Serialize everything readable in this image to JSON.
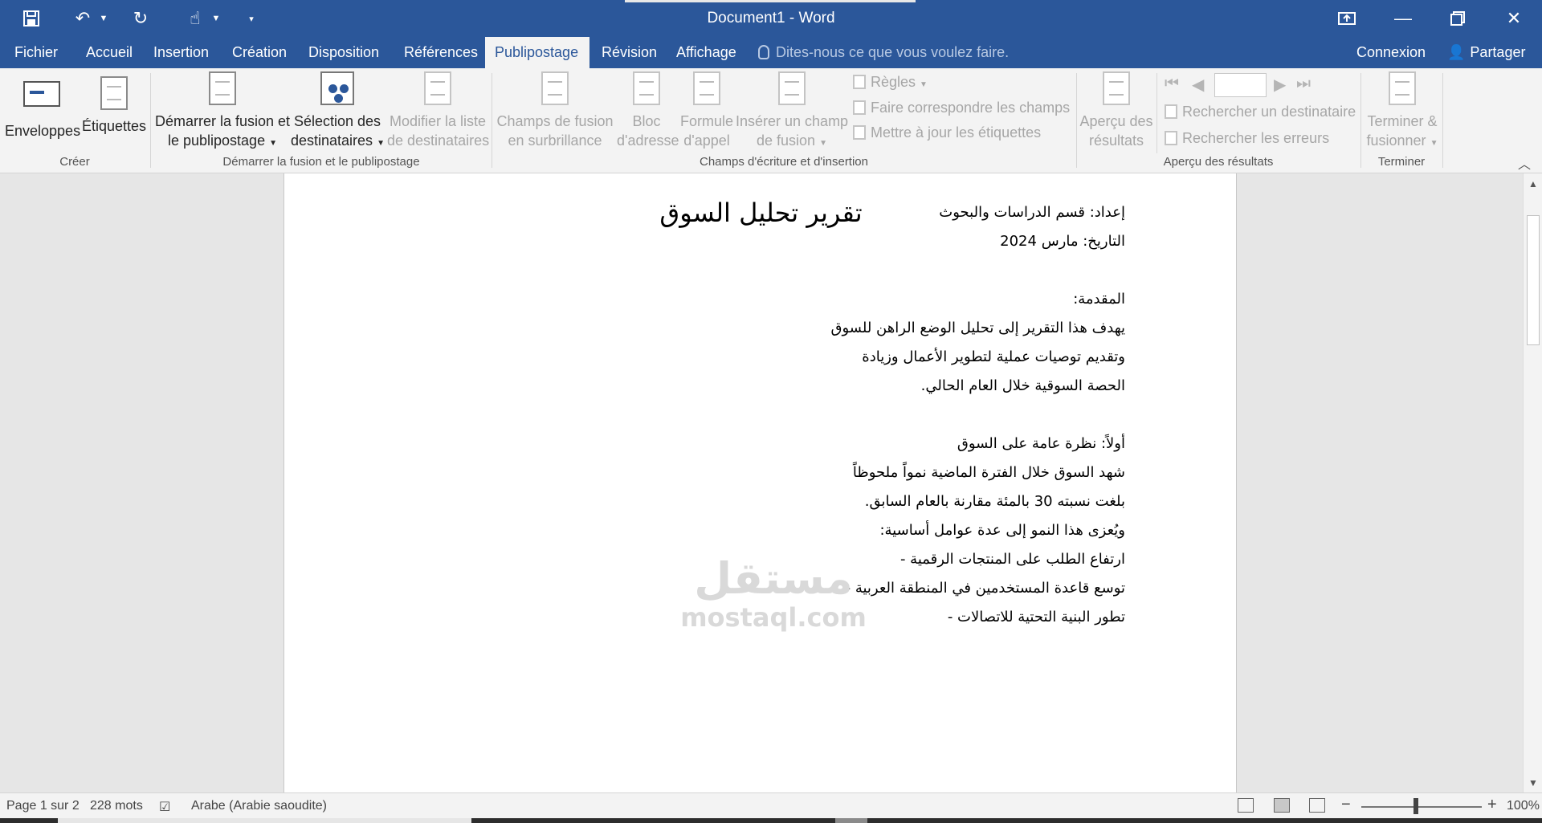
{
  "window": {
    "title": "Document1 - Word",
    "controls": [
      "restore-ribbon",
      "minimize",
      "maximize",
      "close"
    ]
  },
  "quick_access": [
    "save-icon",
    "undo-icon",
    "redo-icon",
    "touch-mode-icon",
    "customize-icon"
  ],
  "tabs": [
    {
      "label": "Fichier"
    },
    {
      "label": "Accueil"
    },
    {
      "label": "Insertion"
    },
    {
      "label": "Création"
    },
    {
      "label": "Disposition"
    },
    {
      "label": "Références"
    },
    {
      "label": "Publipostage",
      "active": true
    },
    {
      "label": "Révision"
    },
    {
      "label": "Affichage"
    }
  ],
  "tell_me": "Dites-nous ce que vous voulez faire.",
  "account": {
    "signin": "Connexion",
    "share": "Partager"
  },
  "ribbon": {
    "create": {
      "label": "Créer",
      "envelopes": "Enveloppes",
      "labels": "Étiquettes"
    },
    "start": {
      "label": "Démarrer la fusion et le publipostage",
      "start_merge_1": "Démarrer la fusion et",
      "start_merge_2": "le publipostage",
      "select_1": "Sélection des",
      "select_2": "destinataires",
      "edit_1": "Modifier la liste",
      "edit_2": "de destinataires"
    },
    "write": {
      "label": "Champs d'écriture et d'insertion",
      "highlight_1": "Champs de fusion",
      "highlight_2": "en surbrillance",
      "address_1": "Bloc",
      "address_2": "d'adresse",
      "greeting_1": "Formule",
      "greeting_2": "d'appel",
      "insert_1": "Insérer un champ",
      "insert_2": "de fusion",
      "rules": "Règles",
      "match": "Faire correspondre les champs",
      "update": "Mettre à jour les étiquettes"
    },
    "preview": {
      "label": "Aperçu des résultats",
      "preview_1": "Aperçu des",
      "preview_2": "résultats",
      "find": "Rechercher un destinataire",
      "check": "Rechercher les erreurs"
    },
    "finish": {
      "label": "Terminer",
      "finish_1": "Terminer &",
      "finish_2": "fusionner"
    }
  },
  "document": {
    "title": "تقرير تحليل السوق",
    "lines": [
      "إعداد: قسم الدراسات والبحوث",
      "التاريخ: مارس 2024",
      "",
      "المقدمة:",
      "يهدف هذا التقرير إلى تحليل الوضع الراهن للسوق",
      "وتقديم توصيات عملية لتطوير الأعمال وزيادة",
      "الحصة السوقية خلال العام الحالي.",
      "",
      "أولاً: نظرة عامة على السوق",
      "شهد السوق خلال الفترة الماضية نمواً ملحوظاً",
      "بلغت نسبته 30 بالمئة مقارنة بالعام السابق.",
      "ويُعزى هذا النمو إلى عدة عوامل أساسية:",
      "ارتفاع الطلب على المنتجات الرقمية -",
      "توسع قاعدة المستخدمين في المنطقة العربية -",
      "تطور البنية التحتية للاتصالات -"
    ]
  },
  "watermark": {
    "arabic": "مستقل",
    "latin": "mostaql.com"
  },
  "status": {
    "page": "Page 1 sur 2",
    "words": "228 mots",
    "language": "Arabe (Arabie saoudite)",
    "zoom": "100%",
    "zoom_minus": "−",
    "zoom_plus": "+"
  },
  "colors": {
    "brand": "#2b579a",
    "ribbon_bg": "#f3f3f3",
    "workspace": "#e6e6e6"
  }
}
